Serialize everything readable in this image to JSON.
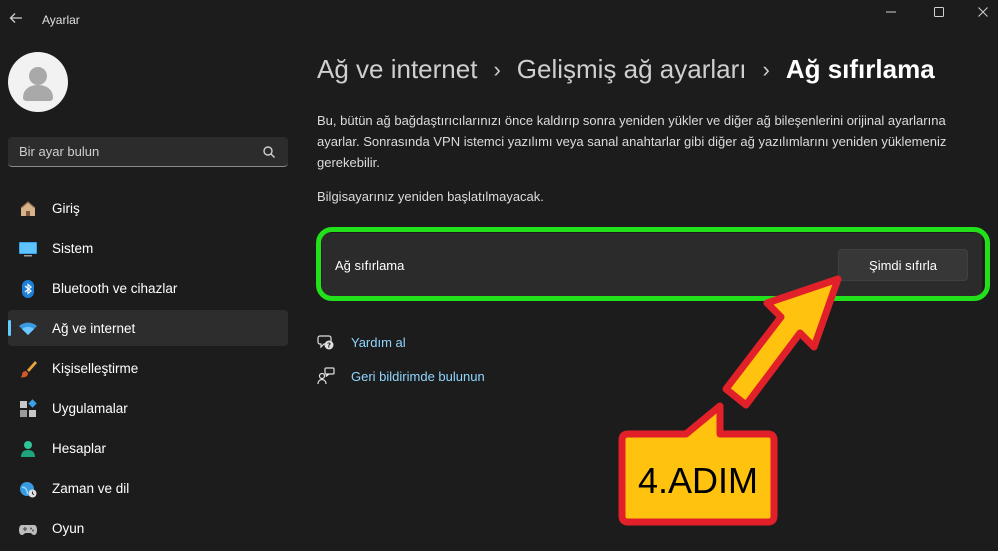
{
  "window": {
    "title": "Ayarlar"
  },
  "search": {
    "placeholder": "Bir ayar bulun"
  },
  "sidebar": {
    "items": [
      {
        "label": "Giriş",
        "icon": "home-icon"
      },
      {
        "label": "Sistem",
        "icon": "monitor-icon"
      },
      {
        "label": "Bluetooth ve cihazlar",
        "icon": "bluetooth-icon"
      },
      {
        "label": "Ağ ve internet",
        "icon": "wifi-icon",
        "active": true
      },
      {
        "label": "Kişiselleştirme",
        "icon": "brush-icon"
      },
      {
        "label": "Uygulamalar",
        "icon": "apps-icon"
      },
      {
        "label": "Hesaplar",
        "icon": "person-icon"
      },
      {
        "label": "Zaman ve dil",
        "icon": "globe-clock-icon"
      },
      {
        "label": "Oyun",
        "icon": "gamepad-icon"
      }
    ]
  },
  "breadcrumb": {
    "item1": "Ağ ve internet",
    "item2": "Gelişmiş ağ ayarları",
    "current": "Ağ sıfırlama"
  },
  "main": {
    "description": "Bu, bütün ağ bağdaştırıcılarınızı önce kaldırıp sonra yeniden yükler ve diğer ağ bileşenlerini orijinal ayarlarına ayarlar. Sonrasında VPN istemci yazılımı veya sanal anahtarlar gibi diğer ağ yazılımlarını yeniden yüklemeniz gerekebilir.",
    "note": "Bilgisayarınız yeniden başlatılmayacak.",
    "reset_card": {
      "label": "Ağ sıfırlama",
      "button": "Şimdi sıfırla"
    },
    "links": {
      "help": "Yardım al",
      "feedback": "Geri bildirimde bulunun"
    }
  },
  "annotation": {
    "step": "4.ADIM",
    "highlight_color": "#22e01a",
    "arrow_color": "#ffc20e",
    "border_color": "#e2202a"
  },
  "colors": {
    "background": "#1c1c1c",
    "accent": "#60cdff",
    "link": "#8fd6ff"
  }
}
